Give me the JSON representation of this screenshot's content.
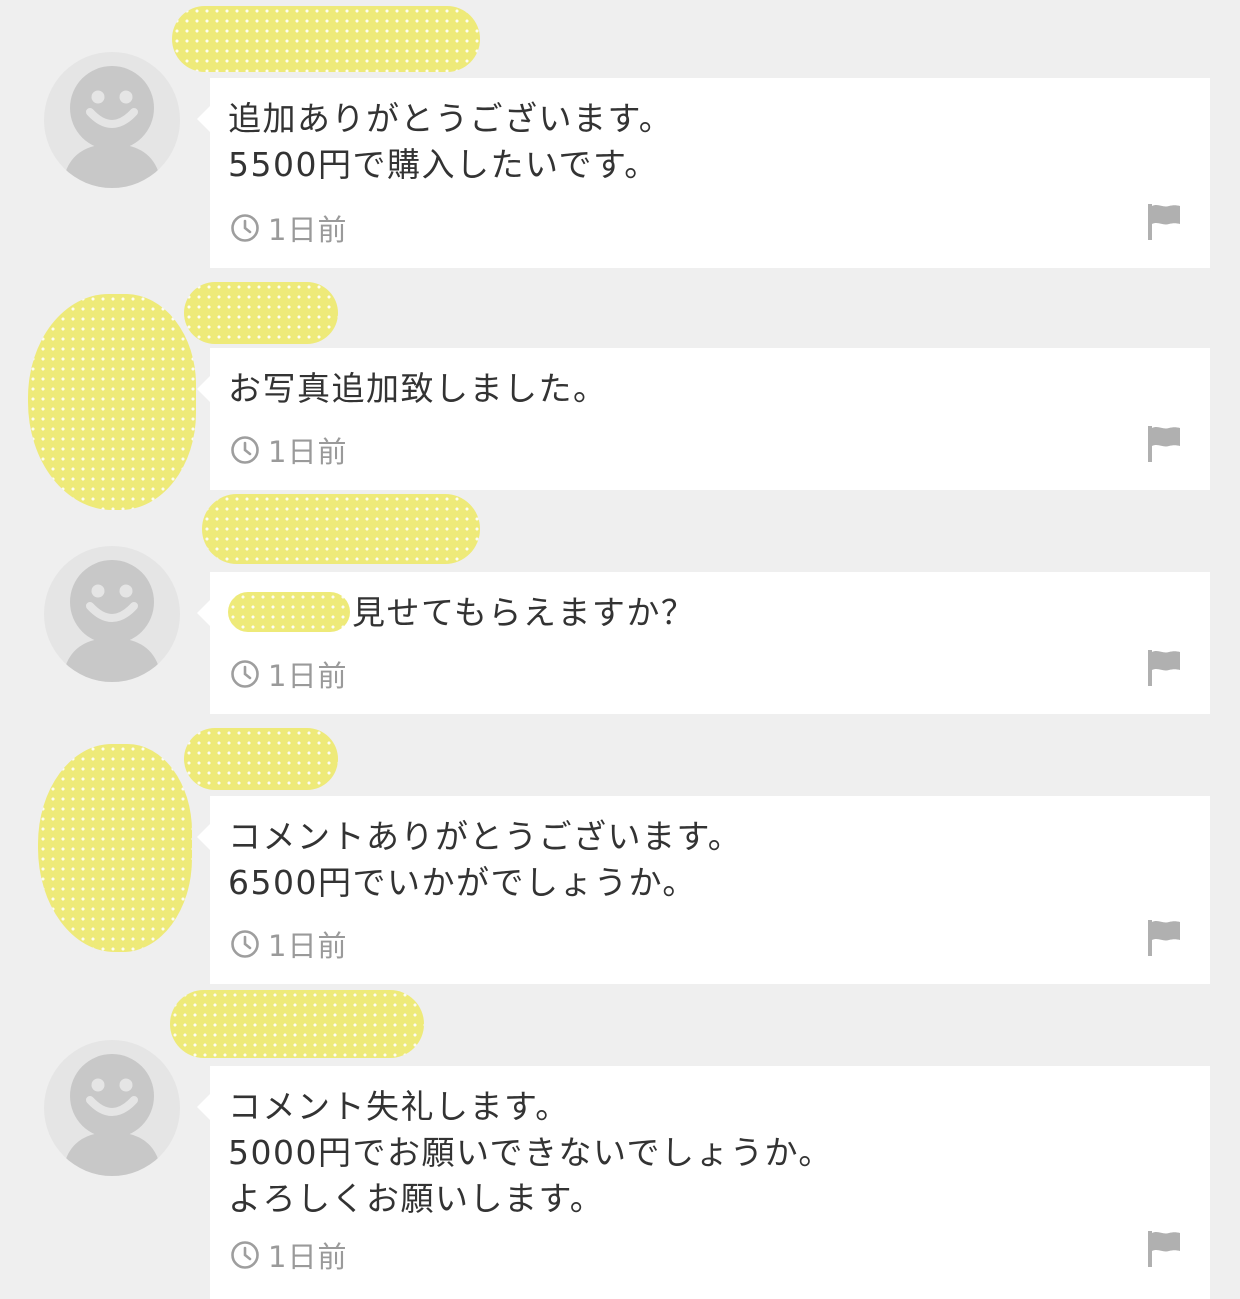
{
  "colors": {
    "background": "#efefef",
    "bubble": "#ffffff",
    "text": "#333333",
    "meta_text": "#9a9a9a",
    "icon": "#b0b0b0",
    "redaction": "#eeea79"
  },
  "icons": {
    "avatar": "default-avatar-icon",
    "time": "clock-icon",
    "report": "flag-icon"
  },
  "comments": [
    {
      "author_redacted": true,
      "avatar": "default",
      "lines": [
        "追加ありがとうございます。",
        "5500円で購入したいです。"
      ],
      "time": "1日前"
    },
    {
      "author_redacted": true,
      "avatar": "redacted",
      "lines": [
        "お写真追加致しました。"
      ],
      "time": "1日前"
    },
    {
      "author_redacted": true,
      "avatar": "default",
      "lines": [
        "見せてもらえますか？"
      ],
      "leading_text_redacted": true,
      "time": "1日前"
    },
    {
      "author_redacted": true,
      "avatar": "redacted",
      "lines": [
        "コメントありがとうございます。",
        "6500円でいかがでしょうか。"
      ],
      "time": "1日前"
    },
    {
      "author_redacted": true,
      "avatar": "default",
      "lines": [
        "コメント失礼します。",
        "5000円でお願いできないでしょうか。",
        "よろしくお願いします。"
      ],
      "time": "1日前"
    }
  ]
}
